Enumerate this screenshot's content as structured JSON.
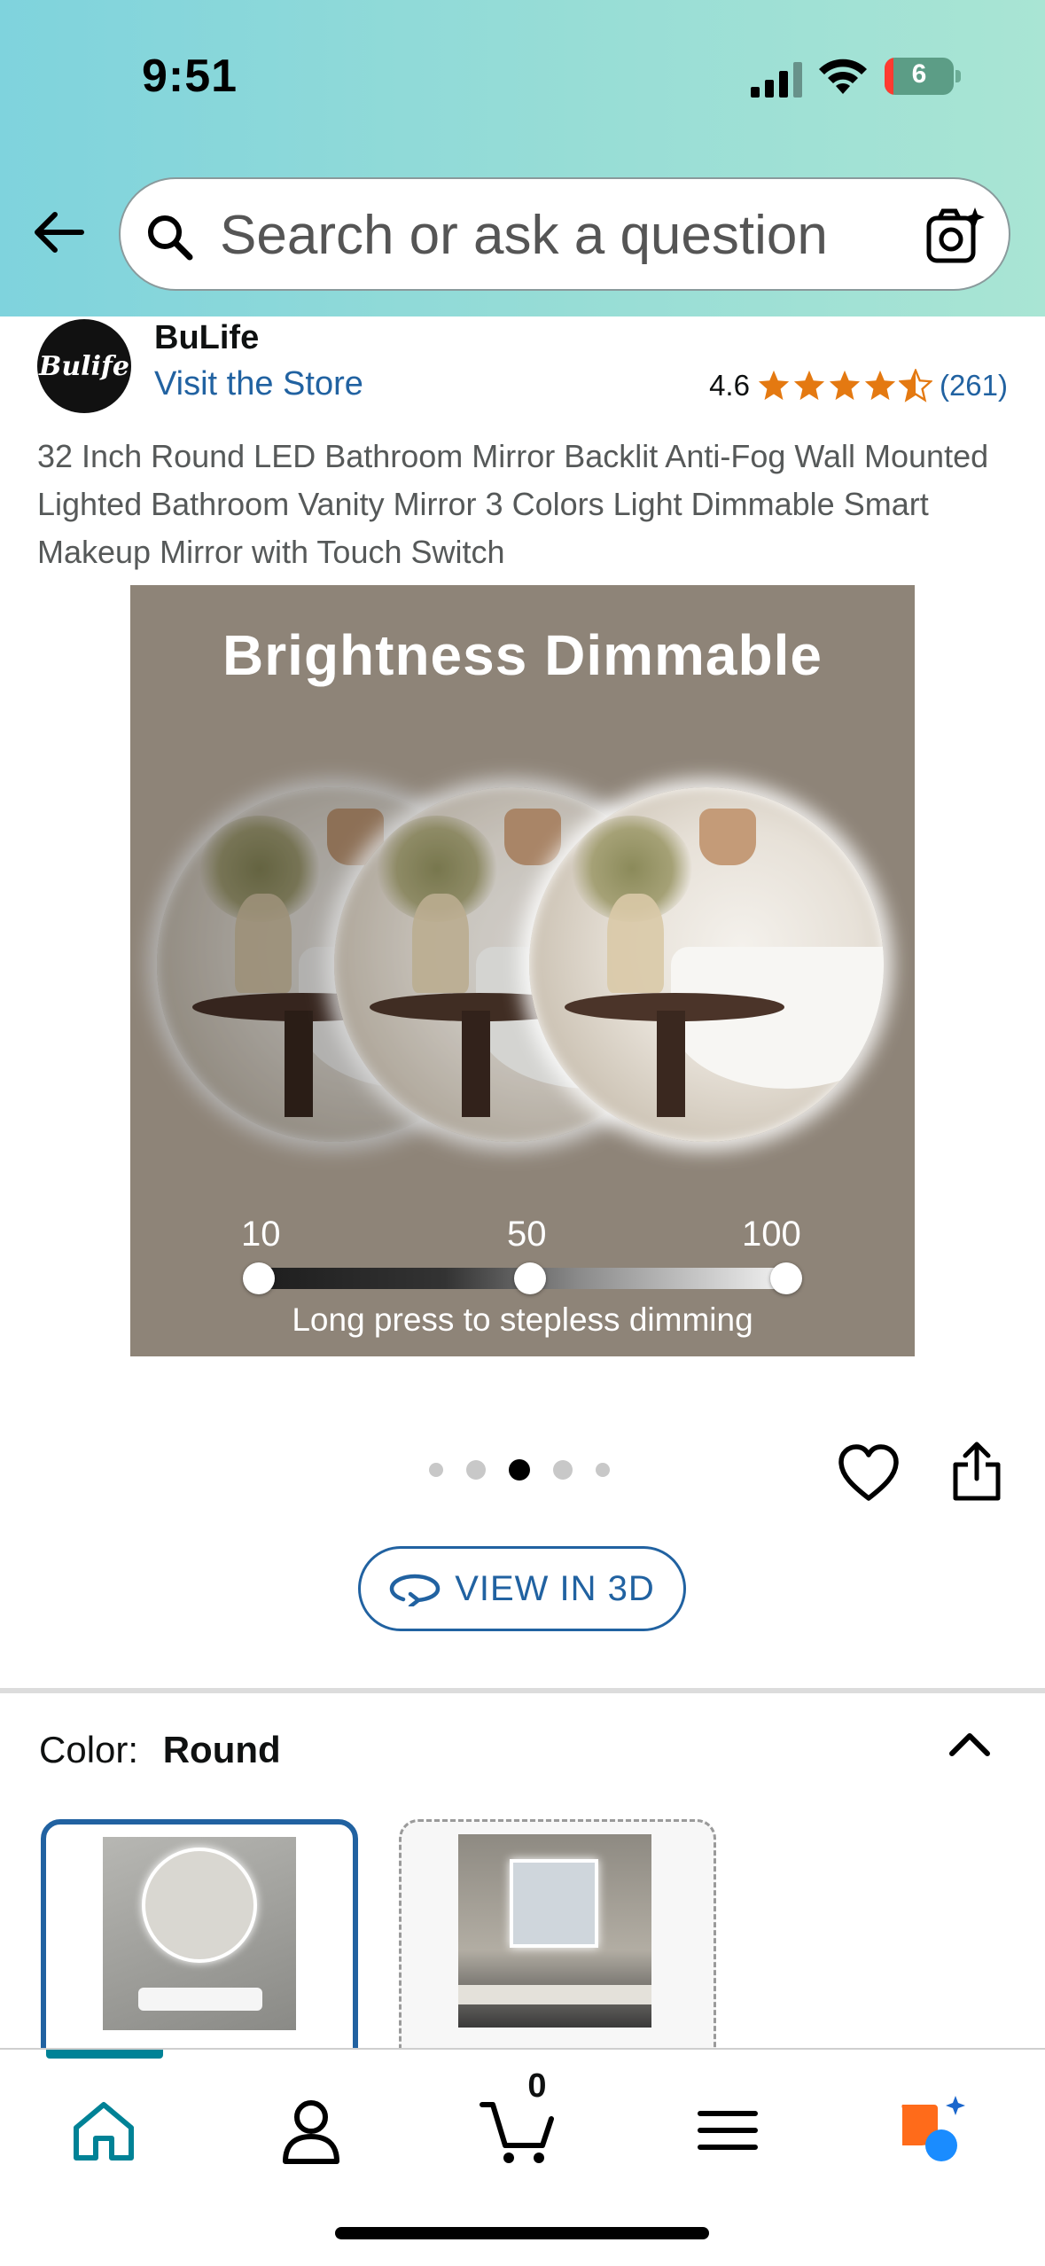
{
  "status_bar": {
    "time": "9:51",
    "battery": "6"
  },
  "search": {
    "placeholder": "Search or ask a question"
  },
  "brand": {
    "logo_text": "Bulife",
    "name": "BuLife",
    "visit_store": "Visit the Store"
  },
  "rating": {
    "value": "4.6",
    "stars": 4.5,
    "count": "(261)"
  },
  "product": {
    "title": "32 Inch Round LED Bathroom Mirror Backlit Anti-Fog Wall Mounted Lighted Bathroom Vanity Mirror 3 Colors Light Dimmable Smart Makeup Mirror with Touch Switch",
    "image": {
      "headline": "Brightness Dimmable",
      "levels": [
        "10",
        "50",
        "100"
      ],
      "caption": "Long press to stepless dimming"
    }
  },
  "carousel": {
    "count": 5,
    "active_index": 2
  },
  "view3d": {
    "label": "VIEW IN 3D"
  },
  "color": {
    "label": "Color:",
    "value": "Round",
    "options": [
      "Round",
      "Square"
    ]
  },
  "tabbar": {
    "cart_count": "0",
    "accent": "#008296"
  },
  "colors": {
    "link": "#2162a1",
    "star": "#e47911",
    "header_start": "#7fd3dd",
    "header_end": "#a9e5d4"
  }
}
